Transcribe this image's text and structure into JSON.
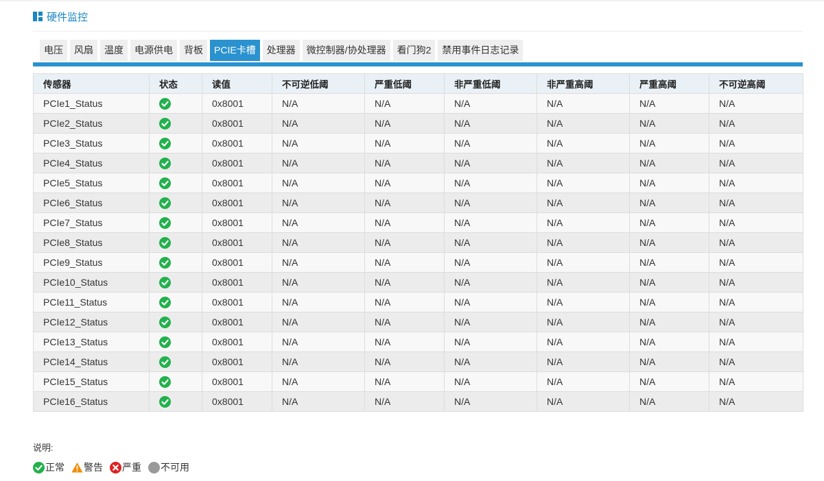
{
  "header": {
    "title": "硬件监控",
    "icon": "dashboard-icon"
  },
  "tabs": [
    {
      "label": "电压",
      "active": false
    },
    {
      "label": "风扇",
      "active": false
    },
    {
      "label": "温度",
      "active": false
    },
    {
      "label": "电源供电",
      "active": false
    },
    {
      "label": "背板",
      "active": false
    },
    {
      "label": "PCIE卡槽",
      "active": true
    },
    {
      "label": "处理器",
      "active": false
    },
    {
      "label": "微控制器/协处理器",
      "active": false
    },
    {
      "label": "看门狗2",
      "active": false
    },
    {
      "label": "禁用事件日志记录",
      "active": false
    }
  ],
  "table": {
    "columns": [
      "传感器",
      "状态",
      "读值",
      "不可逆低阈",
      "严重低阈",
      "非严重低阈",
      "非严重高阈",
      "严重高阈",
      "不可逆高阈"
    ],
    "rows": [
      {
        "sensor": "PCIe1_Status",
        "status": "ok",
        "reading": "0x8001",
        "lnr": "N/A",
        "lc": "N/A",
        "lnc": "N/A",
        "unc": "N/A",
        "uc": "N/A",
        "unr": "N/A"
      },
      {
        "sensor": "PCIe2_Status",
        "status": "ok",
        "reading": "0x8001",
        "lnr": "N/A",
        "lc": "N/A",
        "lnc": "N/A",
        "unc": "N/A",
        "uc": "N/A",
        "unr": "N/A"
      },
      {
        "sensor": "PCIe3_Status",
        "status": "ok",
        "reading": "0x8001",
        "lnr": "N/A",
        "lc": "N/A",
        "lnc": "N/A",
        "unc": "N/A",
        "uc": "N/A",
        "unr": "N/A"
      },
      {
        "sensor": "PCIe4_Status",
        "status": "ok",
        "reading": "0x8001",
        "lnr": "N/A",
        "lc": "N/A",
        "lnc": "N/A",
        "unc": "N/A",
        "uc": "N/A",
        "unr": "N/A"
      },
      {
        "sensor": "PCIe5_Status",
        "status": "ok",
        "reading": "0x8001",
        "lnr": "N/A",
        "lc": "N/A",
        "lnc": "N/A",
        "unc": "N/A",
        "uc": "N/A",
        "unr": "N/A"
      },
      {
        "sensor": "PCIe6_Status",
        "status": "ok",
        "reading": "0x8001",
        "lnr": "N/A",
        "lc": "N/A",
        "lnc": "N/A",
        "unc": "N/A",
        "uc": "N/A",
        "unr": "N/A"
      },
      {
        "sensor": "PCIe7_Status",
        "status": "ok",
        "reading": "0x8001",
        "lnr": "N/A",
        "lc": "N/A",
        "lnc": "N/A",
        "unc": "N/A",
        "uc": "N/A",
        "unr": "N/A"
      },
      {
        "sensor": "PCIe8_Status",
        "status": "ok",
        "reading": "0x8001",
        "lnr": "N/A",
        "lc": "N/A",
        "lnc": "N/A",
        "unc": "N/A",
        "uc": "N/A",
        "unr": "N/A"
      },
      {
        "sensor": "PCIe9_Status",
        "status": "ok",
        "reading": "0x8001",
        "lnr": "N/A",
        "lc": "N/A",
        "lnc": "N/A",
        "unc": "N/A",
        "uc": "N/A",
        "unr": "N/A"
      },
      {
        "sensor": "PCIe10_Status",
        "status": "ok",
        "reading": "0x8001",
        "lnr": "N/A",
        "lc": "N/A",
        "lnc": "N/A",
        "unc": "N/A",
        "uc": "N/A",
        "unr": "N/A"
      },
      {
        "sensor": "PCIe11_Status",
        "status": "ok",
        "reading": "0x8001",
        "lnr": "N/A",
        "lc": "N/A",
        "lnc": "N/A",
        "unc": "N/A",
        "uc": "N/A",
        "unr": "N/A"
      },
      {
        "sensor": "PCIe12_Status",
        "status": "ok",
        "reading": "0x8001",
        "lnr": "N/A",
        "lc": "N/A",
        "lnc": "N/A",
        "unc": "N/A",
        "uc": "N/A",
        "unr": "N/A"
      },
      {
        "sensor": "PCIe13_Status",
        "status": "ok",
        "reading": "0x8001",
        "lnr": "N/A",
        "lc": "N/A",
        "lnc": "N/A",
        "unc": "N/A",
        "uc": "N/A",
        "unr": "N/A"
      },
      {
        "sensor": "PCIe14_Status",
        "status": "ok",
        "reading": "0x8001",
        "lnr": "N/A",
        "lc": "N/A",
        "lnc": "N/A",
        "unc": "N/A",
        "uc": "N/A",
        "unr": "N/A"
      },
      {
        "sensor": "PCIe15_Status",
        "status": "ok",
        "reading": "0x8001",
        "lnr": "N/A",
        "lc": "N/A",
        "lnc": "N/A",
        "unc": "N/A",
        "uc": "N/A",
        "unr": "N/A"
      },
      {
        "sensor": "PCIe16_Status",
        "status": "ok",
        "reading": "0x8001",
        "lnr": "N/A",
        "lc": "N/A",
        "lnc": "N/A",
        "unc": "N/A",
        "uc": "N/A",
        "unr": "N/A"
      }
    ]
  },
  "legend": {
    "title": "说明:",
    "items": [
      {
        "label": "正常",
        "icon": "check-circle-icon",
        "color": "#22b14c"
      },
      {
        "label": "警告",
        "icon": "warning-triangle-icon",
        "color": "#f08c00"
      },
      {
        "label": "严重",
        "icon": "error-circle-icon",
        "color": "#e02020"
      },
      {
        "label": "不可用",
        "icon": "unavailable-circle-icon",
        "color": "#999999"
      }
    ]
  },
  "colors": {
    "accent": "#2a92cf",
    "title": "#1b86c2",
    "ok": "#22b14c"
  }
}
